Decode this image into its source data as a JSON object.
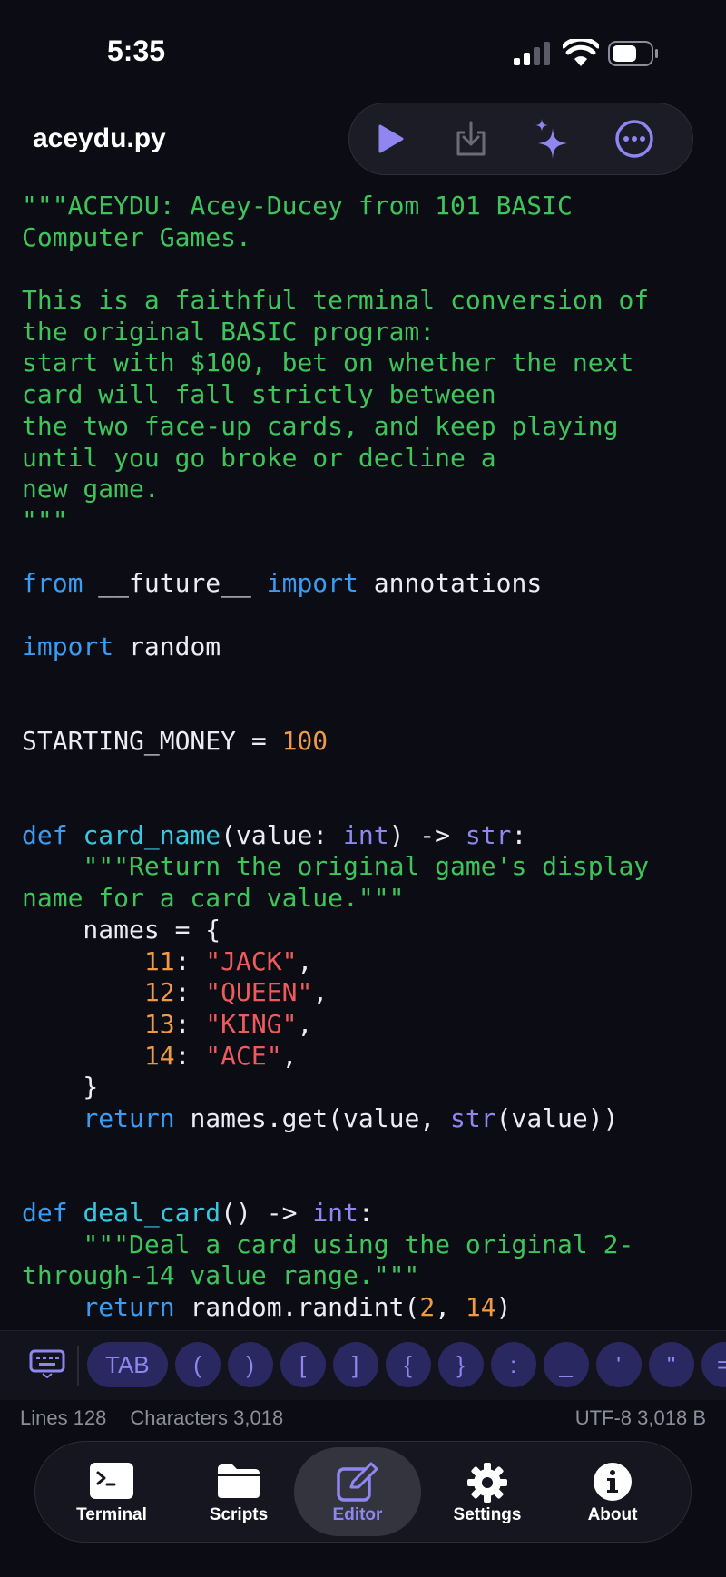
{
  "status_bar": {
    "time": "5:35"
  },
  "header": {
    "file_name": "aceydu.py"
  },
  "toolbar": {
    "buttons": [
      "play-icon",
      "download-icon",
      "sparkles-icon",
      "more-icon"
    ]
  },
  "code_lines": [
    [
      {
        "t": "\"\"\"ACEYDU: Acey-Ducey from 101 BASIC",
        "c": "cm"
      }
    ],
    [
      {
        "t": "Computer Games.",
        "c": "cm"
      }
    ],
    [],
    [
      {
        "t": "This is a faithful terminal conversion of",
        "c": "cm"
      }
    ],
    [
      {
        "t": "the original BASIC program:",
        "c": "cm"
      }
    ],
    [
      {
        "t": "start with $100, bet on whether the next",
        "c": "cm"
      }
    ],
    [
      {
        "t": "card will fall strictly between",
        "c": "cm"
      }
    ],
    [
      {
        "t": "the two face-up cards, and keep playing",
        "c": "cm"
      }
    ],
    [
      {
        "t": "until you go broke or decline a",
        "c": "cm"
      }
    ],
    [
      {
        "t": "new game.",
        "c": "cm"
      }
    ],
    [
      {
        "t": "\"\"\"",
        "c": "cm"
      }
    ],
    [],
    [
      {
        "t": "from",
        "c": "kw"
      },
      {
        "t": " __future__ "
      },
      {
        "t": "import",
        "c": "kw"
      },
      {
        "t": " annotations"
      }
    ],
    [],
    [
      {
        "t": "import",
        "c": "kw"
      },
      {
        "t": " random"
      }
    ],
    [],
    [],
    [
      {
        "t": "STARTING_MONEY = "
      },
      {
        "t": "100",
        "c": "nm"
      }
    ],
    [],
    [],
    [
      {
        "t": "def",
        "c": "kw"
      },
      {
        "t": " "
      },
      {
        "t": "card_name",
        "c": "fn"
      },
      {
        "t": "(value: "
      },
      {
        "t": "int",
        "c": "ty"
      },
      {
        "t": ") -> "
      },
      {
        "t": "str",
        "c": "ty"
      },
      {
        "t": ":"
      }
    ],
    [
      {
        "t": "    "
      },
      {
        "t": "\"\"\"Return the original game's display",
        "c": "cm"
      }
    ],
    [
      {
        "t": "name for a card value.\"\"\"",
        "c": "cm"
      }
    ],
    [
      {
        "t": "    names = {"
      }
    ],
    [
      {
        "t": "        "
      },
      {
        "t": "11",
        "c": "nm"
      },
      {
        "t": ": "
      },
      {
        "t": "\"JACK\"",
        "c": "st"
      },
      {
        "t": ","
      }
    ],
    [
      {
        "t": "        "
      },
      {
        "t": "12",
        "c": "nm"
      },
      {
        "t": ": "
      },
      {
        "t": "\"QUEEN\"",
        "c": "st"
      },
      {
        "t": ","
      }
    ],
    [
      {
        "t": "        "
      },
      {
        "t": "13",
        "c": "nm"
      },
      {
        "t": ": "
      },
      {
        "t": "\"KING\"",
        "c": "st"
      },
      {
        "t": ","
      }
    ],
    [
      {
        "t": "        "
      },
      {
        "t": "14",
        "c": "nm"
      },
      {
        "t": ": "
      },
      {
        "t": "\"ACE\"",
        "c": "st"
      },
      {
        "t": ","
      }
    ],
    [
      {
        "t": "    }"
      }
    ],
    [
      {
        "t": "    "
      },
      {
        "t": "return",
        "c": "kw"
      },
      {
        "t": " names.get(value, "
      },
      {
        "t": "str",
        "c": "ty"
      },
      {
        "t": "(value))"
      }
    ],
    [],
    [],
    [
      {
        "t": "def",
        "c": "kw"
      },
      {
        "t": " "
      },
      {
        "t": "deal_card",
        "c": "fn"
      },
      {
        "t": "() -> "
      },
      {
        "t": "int",
        "c": "ty"
      },
      {
        "t": ":"
      }
    ],
    [
      {
        "t": "    "
      },
      {
        "t": "\"\"\"Deal a card using the original 2-",
        "c": "cm"
      }
    ],
    [
      {
        "t": "through-14 value range.\"\"\"",
        "c": "cm"
      }
    ],
    [
      {
        "t": "    "
      },
      {
        "t": "return",
        "c": "kw"
      },
      {
        "t": " random.randint("
      },
      {
        "t": "2",
        "c": "nm"
      },
      {
        "t": ", "
      },
      {
        "t": "14",
        "c": "nm"
      },
      {
        "t": ")"
      }
    ]
  ],
  "accessory_keys": [
    "TAB",
    "(",
    ")",
    "[",
    "]",
    "{",
    "}",
    ":",
    "_",
    "'",
    "\"",
    "="
  ],
  "info": {
    "lines": "Lines 128",
    "characters": "Characters 3,018",
    "encoding": "UTF-8 3,018 B"
  },
  "tabs": [
    {
      "label": "Terminal",
      "icon": "terminal-icon",
      "active": false
    },
    {
      "label": "Scripts",
      "icon": "folder-icon",
      "active": false
    },
    {
      "label": "Editor",
      "icon": "edit-icon",
      "active": true
    },
    {
      "label": "Settings",
      "icon": "gear-icon",
      "active": false
    },
    {
      "label": "About",
      "icon": "info-icon",
      "active": false
    }
  ],
  "colors": {
    "accent": "#8f86f0",
    "comment": "#3fc45b",
    "keyword": "#3a9df3",
    "function": "#38c7df",
    "number": "#ef9a45",
    "string": "#ef5b5b"
  }
}
